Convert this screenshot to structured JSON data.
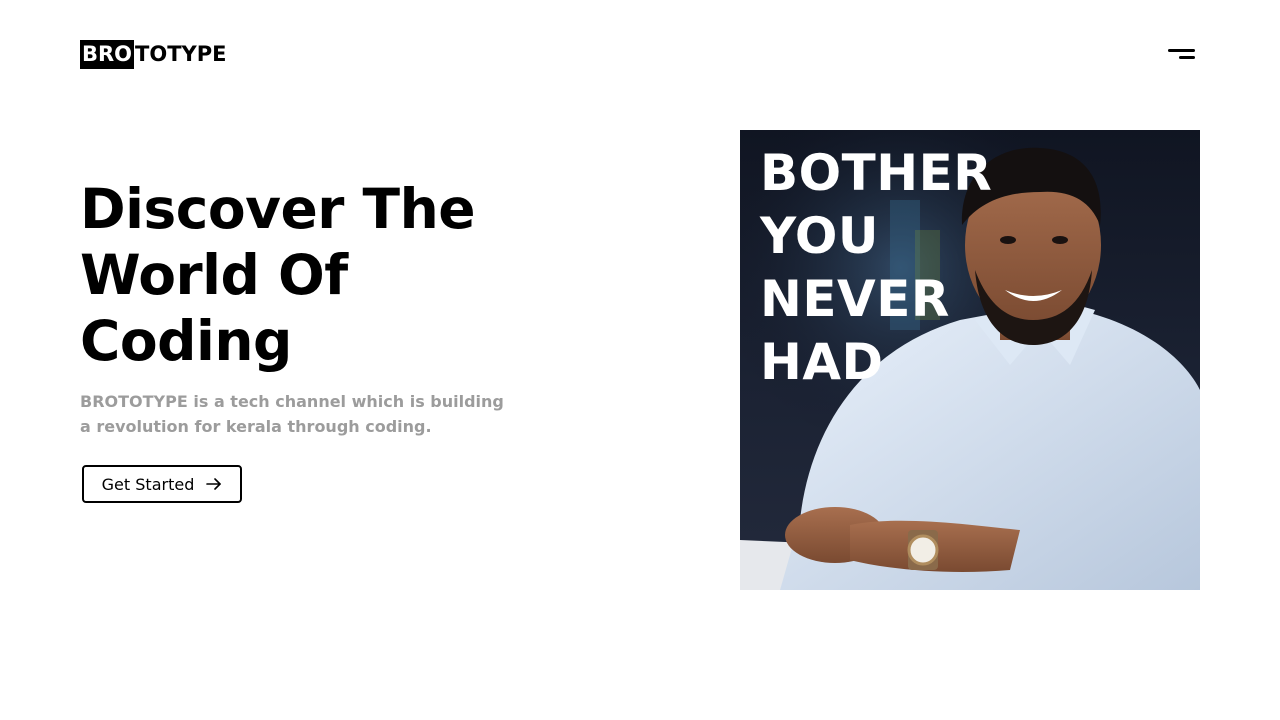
{
  "header": {
    "logo_box": "BRO",
    "logo_rest": "TOTYPE"
  },
  "hero": {
    "title_lines": [
      "Discover The",
      "World Of",
      "Coding"
    ],
    "description": "BROTOTYPE is a tech channel which is building a revolution for kerala through coding.",
    "cta_label": "Get Started",
    "image_text_lines": [
      "BOTHER",
      "YOU",
      "NEVER",
      "HAD"
    ]
  },
  "colors": {
    "text": "#000000",
    "muted_text": "#9c9c9c",
    "background": "#ffffff",
    "image_background": "#151b29"
  },
  "icons": {
    "menu": "hamburger-icon",
    "cta": "arrow-right-icon"
  }
}
